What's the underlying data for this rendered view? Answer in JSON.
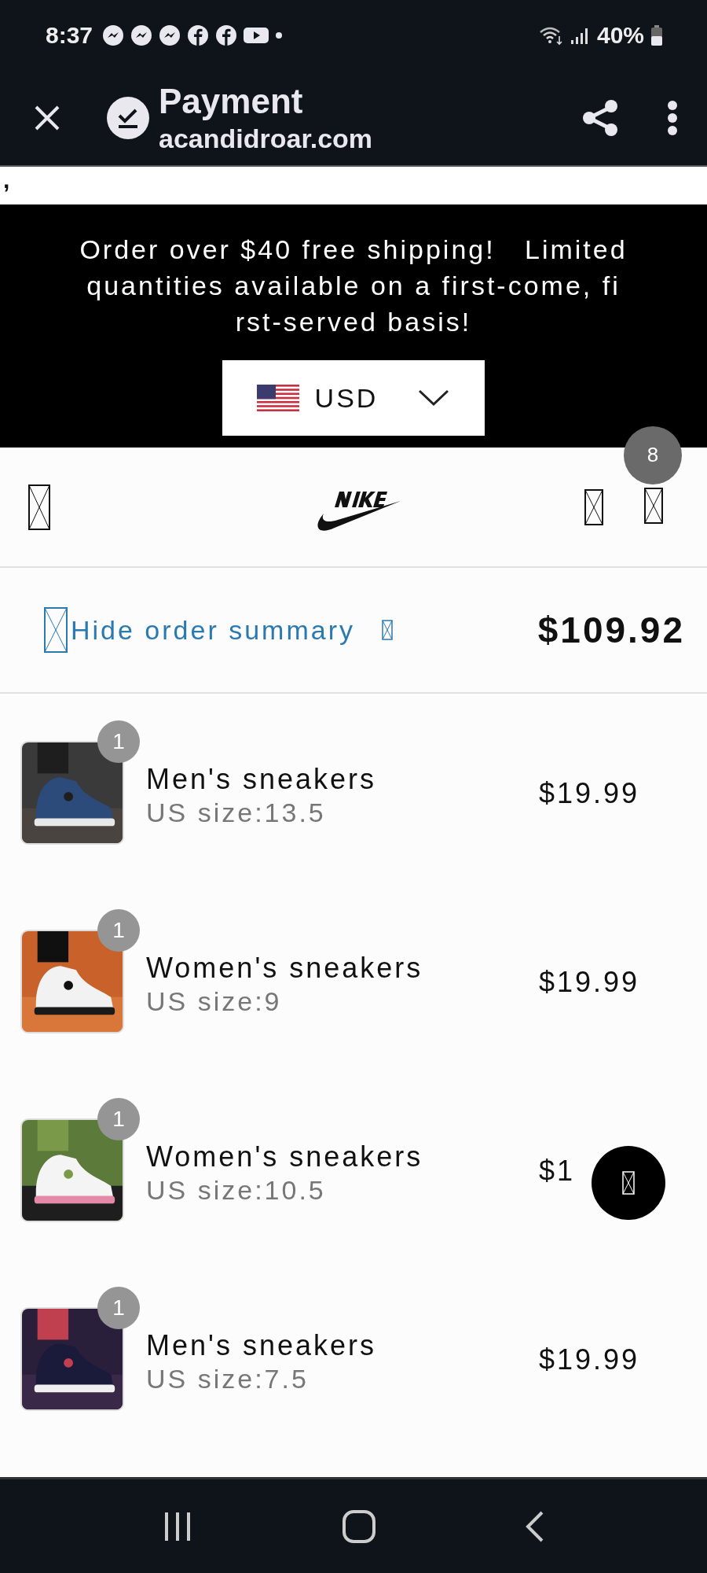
{
  "status_bar": {
    "time": "8:37",
    "battery": "40%"
  },
  "browser": {
    "title": "Payment",
    "url": "acandidroar.com"
  },
  "stray_text": ",",
  "banner": {
    "lines": [
      "Order over $40 free shipping!   Limited",
      "quantities available on a first-come, fi",
      "rst-served basis!"
    ],
    "currency": "USD"
  },
  "cart": {
    "count": "8"
  },
  "summary": {
    "toggle": "Hide order summary",
    "total": "$109.92"
  },
  "items": [
    {
      "name": "Men's sneakers",
      "variant": "US size:13.5",
      "price": "$19.99",
      "quantity": "1"
    },
    {
      "name": "Women's sneakers",
      "variant": "US size:9",
      "price": "$19.99",
      "quantity": "1"
    },
    {
      "name": "Women's sneakers",
      "variant": "US size:10.5",
      "price": "$1",
      "quantity": "1"
    },
    {
      "name": "Men's sneakers",
      "variant": "US size:7.5",
      "price": "$19.99",
      "quantity": "1"
    }
  ]
}
